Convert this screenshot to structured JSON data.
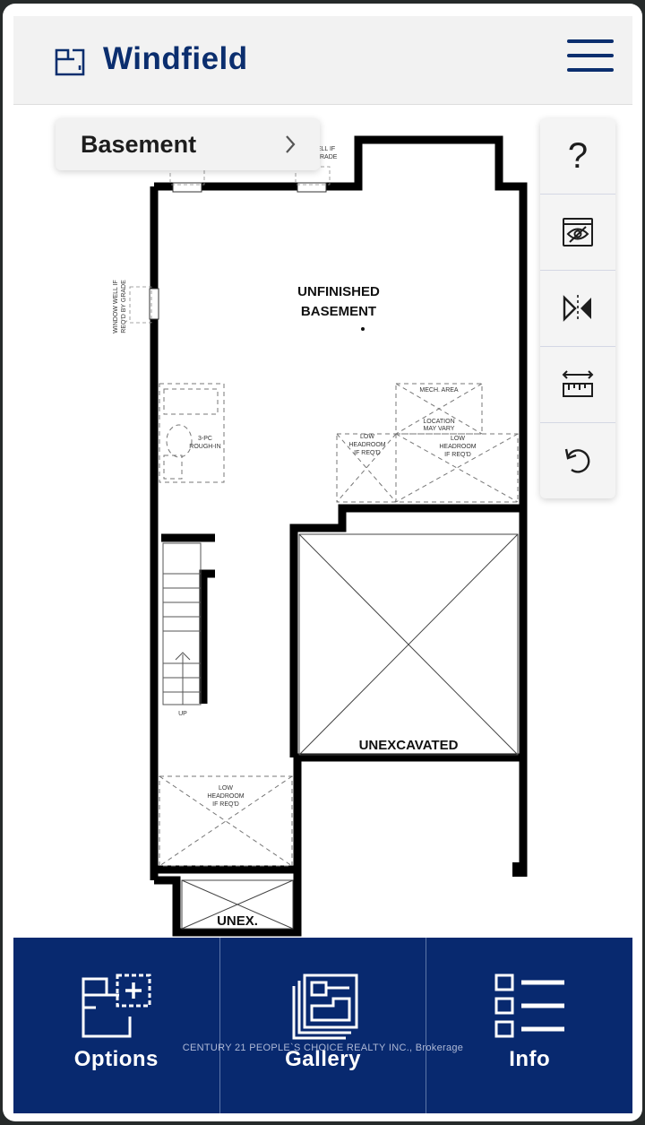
{
  "header": {
    "app_title": "Windfield",
    "logo_icon": "floorplan-logo-icon",
    "menu_icon": "hamburger-menu-icon"
  },
  "floor_selector": {
    "label": "Basement",
    "icon": "chevron-right-icon"
  },
  "toolbar": {
    "items": [
      {
        "name": "help",
        "glyph": "?",
        "icon": "question-icon"
      },
      {
        "name": "hide-furniture",
        "icon": "eye-slash-icon"
      },
      {
        "name": "mirror",
        "icon": "flip-horizontal-icon"
      },
      {
        "name": "measure",
        "icon": "ruler-icon"
      },
      {
        "name": "reset",
        "icon": "undo-icon"
      }
    ]
  },
  "floorplan": {
    "room_labels": {
      "main_line1": "UNFINISHED",
      "main_line2": "BASEMENT",
      "unexcavated": "UNEXCAVATED",
      "unex": "UNEX."
    },
    "annotations": {
      "well_top_1": "ELL IF",
      "well_top_2": "GRADE",
      "window_well_1": "WINDOW WELL IF",
      "window_well_2": "REQ'D BY GRADE",
      "roughin_1": "3-PC",
      "roughin_2": "ROUGH-IN",
      "mech": "MECH. AREA",
      "location_1": "LOCATION",
      "location_2": "MAY VARY",
      "lowhead_a_1": "LOW",
      "lowhead_a_2": "HEADROOM",
      "lowhead_a_3": "IF REQ'D",
      "lowhead_b_1": "LOW",
      "lowhead_b_2": "HEADROOM",
      "lowhead_b_3": "IF REQ'D",
      "lowhead_c_1": "LOW",
      "lowhead_c_2": "HEADROOM",
      "lowhead_c_3": "IF REQ'D",
      "stairs_up": "UP"
    }
  },
  "bottom_nav": {
    "items": [
      {
        "label": "Options",
        "icon": "floorplan-plus-icon"
      },
      {
        "label": "Gallery",
        "icon": "gallery-stack-icon"
      },
      {
        "label": "Info",
        "icon": "list-icon"
      }
    ],
    "watermark": "CENTURY 21 PEOPLE`S CHOICE REALTY INC., Brokerage"
  },
  "colors": {
    "brand_navy": "#0b2e6e",
    "nav_background": "#08296f",
    "wall": "#000000"
  }
}
